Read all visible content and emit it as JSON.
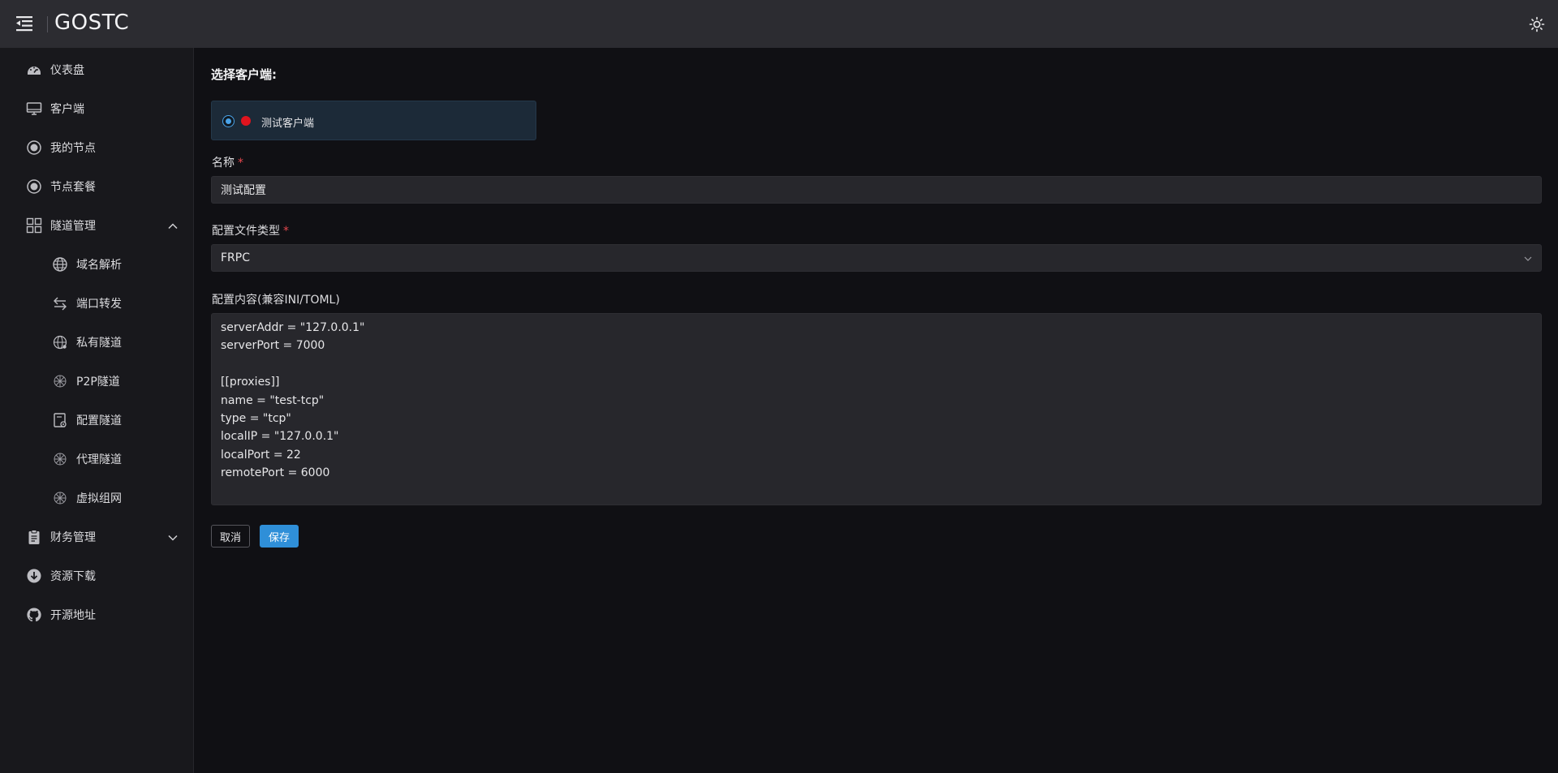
{
  "app": {
    "brand": "GOSTC"
  },
  "sidebar": {
    "items": [
      {
        "label": "仪表盘",
        "icon": "dashboard-icon"
      },
      {
        "label": "客户端",
        "icon": "monitor-icon"
      },
      {
        "label": "我的节点",
        "icon": "node-icon"
      },
      {
        "label": "节点套餐",
        "icon": "package-icon"
      },
      {
        "label": "隧道管理",
        "icon": "grid-icon",
        "expanded": true
      },
      {
        "label": "域名解析",
        "icon": "globe-icon",
        "sub": true
      },
      {
        "label": "端口转发",
        "icon": "swap-icon",
        "sub": true
      },
      {
        "label": "私有隧道",
        "icon": "network-globe-icon",
        "sub": true
      },
      {
        "label": "P2P隧道",
        "icon": "p2p-icon",
        "sub": true
      },
      {
        "label": "配置隧道",
        "icon": "config-file-icon",
        "sub": true
      },
      {
        "label": "代理隧道",
        "icon": "proxy-icon",
        "sub": true
      },
      {
        "label": "虚拟组网",
        "icon": "mesh-icon",
        "sub": true
      },
      {
        "label": "财务管理",
        "icon": "clipboard-icon",
        "expanded": false
      },
      {
        "label": "资源下载",
        "icon": "download-icon"
      },
      {
        "label": "开源地址",
        "icon": "github-icon"
      }
    ]
  },
  "form": {
    "section_title": "选择客户端:",
    "client": {
      "name": "测试客户端",
      "selected": true,
      "status_color": "#e0141e"
    },
    "name_label": "名称",
    "name_value": "测试配置",
    "type_label": "配置文件类型",
    "type_value": "FRPC",
    "content_label": "配置内容(兼容INI/TOML)",
    "content_lines": [
      "serverAddr = \"127.0.0.1\"",
      "serverPort = 7000",
      "",
      "[[proxies]]",
      "name = \"test-tcp\"",
      "type = \"tcp\"",
      "localIP = \"127.0.0.1\"",
      "localPort = 22",
      "remotePort = 6000"
    ],
    "required_mark": "*",
    "cancel_label": "取消",
    "save_label": "保存"
  },
  "colors": {
    "accent": "#2f8fd8",
    "required": "#e5484d"
  }
}
